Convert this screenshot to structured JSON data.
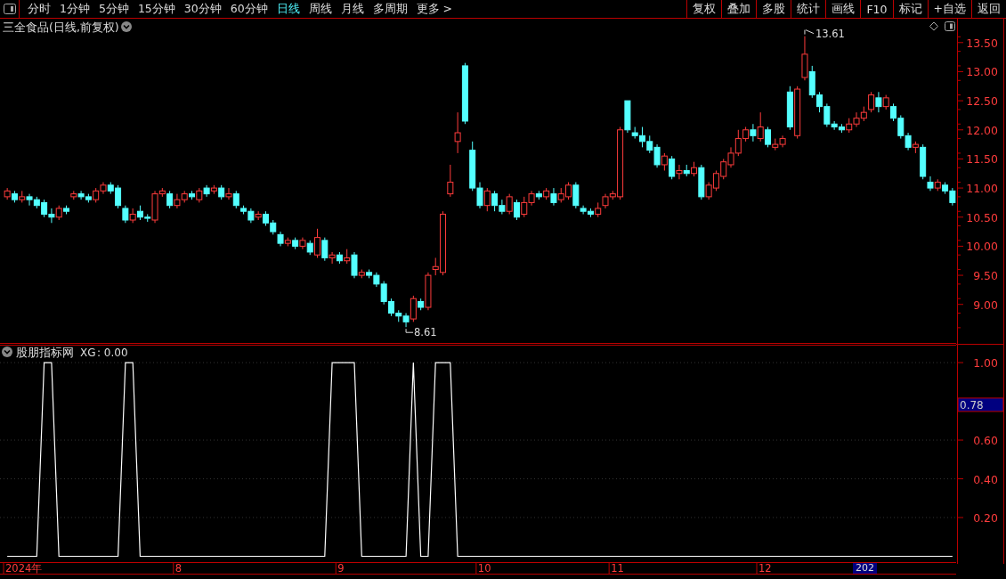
{
  "toolbar": {
    "periods": [
      {
        "label": "分时",
        "selected": false
      },
      {
        "label": "1分钟",
        "selected": false
      },
      {
        "label": "5分钟",
        "selected": false
      },
      {
        "label": "15分钟",
        "selected": false
      },
      {
        "label": "30分钟",
        "selected": false
      },
      {
        "label": "60分钟",
        "selected": false
      },
      {
        "label": "日线",
        "selected": true
      },
      {
        "label": "周线",
        "selected": false
      },
      {
        "label": "月线",
        "selected": false
      },
      {
        "label": "多周期",
        "selected": false
      },
      {
        "label": "更多 >",
        "selected": false
      }
    ],
    "buttons": [
      "复权",
      "叠加",
      "多股",
      "统计",
      "画线",
      "F10",
      "标记",
      "+自选",
      "返回"
    ]
  },
  "price_chart": {
    "title": "三全食品(日线,前复权)",
    "high_label": "13.61",
    "low_label": "8.61",
    "chart_data": {
      "type": "candlestick",
      "yticks": [
        {
          "value": 13.5,
          "label": "13.50"
        },
        {
          "value": 13,
          "label": "13.00"
        },
        {
          "value": 12.5,
          "label": "12.50"
        },
        {
          "value": 12,
          "label": "12.00"
        },
        {
          "value": 11.5,
          "label": "11.50"
        },
        {
          "value": 11,
          "label": "11.00"
        },
        {
          "value": 10.5,
          "label": "10.50"
        },
        {
          "value": 10,
          "label": "10.00"
        },
        {
          "value": 9.5,
          "label": "9.50"
        },
        {
          "value": 9,
          "label": "9.00"
        }
      ],
      "ylim": [
        8.33,
        13.91
      ],
      "categories": [
        null,
        null,
        null,
        null,
        null,
        null,
        null,
        null,
        null,
        null,
        null,
        null,
        null,
        null,
        null,
        null,
        null,
        null,
        null,
        null,
        null,
        null,
        null,
        null,
        null,
        null,
        null,
        null,
        null,
        null,
        null,
        null,
        null,
        null,
        null,
        null,
        null,
        null,
        null,
        null,
        null,
        null,
        null,
        null,
        null,
        null,
        null,
        null,
        null,
        null,
        null,
        null,
        null,
        null,
        null,
        null,
        null,
        null,
        null,
        null,
        null,
        null,
        null,
        null,
        null,
        null,
        null,
        null,
        null,
        null,
        null,
        null,
        null,
        null,
        null,
        null,
        null,
        null,
        null,
        null,
        null,
        null,
        null,
        null,
        null,
        null,
        null,
        null,
        null,
        null,
        null,
        null,
        null,
        null,
        null,
        null,
        null,
        null,
        null,
        null,
        null,
        null,
        null,
        null,
        null,
        null,
        null,
        null,
        null,
        null,
        null,
        null,
        null,
        null,
        null,
        null,
        null,
        null,
        null,
        null,
        null,
        null,
        null,
        null,
        null,
        null,
        null,
        null,
        null
      ],
      "ohlc": [
        [
          10.85,
          11.0,
          10.8,
          10.95
        ],
        [
          10.9,
          10.95,
          10.75,
          10.8
        ],
        [
          10.8,
          10.95,
          10.75,
          10.85
        ],
        [
          10.85,
          10.9,
          10.7,
          10.8
        ],
        [
          10.8,
          10.85,
          10.65,
          10.7
        ],
        [
          10.75,
          10.8,
          10.5,
          10.55
        ],
        [
          10.55,
          10.65,
          10.4,
          10.5
        ],
        [
          10.5,
          10.7,
          10.45,
          10.65
        ],
        [
          10.65,
          10.7,
          10.55,
          10.6
        ],
        [
          10.85,
          10.95,
          10.8,
          10.9
        ],
        [
          10.9,
          10.95,
          10.8,
          10.85
        ],
        [
          10.85,
          10.9,
          10.75,
          10.8
        ],
        [
          10.8,
          11.0,
          10.75,
          10.95
        ],
        [
          10.95,
          11.1,
          10.9,
          11.05
        ],
        [
          11.05,
          11.1,
          10.9,
          10.95
        ],
        [
          11.0,
          11.05,
          10.65,
          10.7
        ],
        [
          10.65,
          10.7,
          10.4,
          10.45
        ],
        [
          10.45,
          10.65,
          10.4,
          10.55
        ],
        [
          10.6,
          10.7,
          10.45,
          10.5
        ],
        [
          10.5,
          10.55,
          10.42,
          10.48
        ],
        [
          10.45,
          10.95,
          10.4,
          10.9
        ],
        [
          10.9,
          11.0,
          10.85,
          10.95
        ],
        [
          10.9,
          10.95,
          10.65,
          10.7
        ],
        [
          10.7,
          10.9,
          10.65,
          10.8
        ],
        [
          10.8,
          10.95,
          10.75,
          10.9
        ],
        [
          10.9,
          10.95,
          10.8,
          10.85
        ],
        [
          10.8,
          11.0,
          10.75,
          10.95
        ],
        [
          11.0,
          11.05,
          10.85,
          10.9
        ],
        [
          10.95,
          11.05,
          10.9,
          11.0
        ],
        [
          11.0,
          11.05,
          10.8,
          10.85
        ],
        [
          10.85,
          11.0,
          10.8,
          10.9
        ],
        [
          10.9,
          10.95,
          10.65,
          10.7
        ],
        [
          10.65,
          10.7,
          10.55,
          10.6
        ],
        [
          10.6,
          10.65,
          10.4,
          10.45
        ],
        [
          10.5,
          10.6,
          10.45,
          10.55
        ],
        [
          10.55,
          10.6,
          10.35,
          10.4
        ],
        [
          10.4,
          10.45,
          10.2,
          10.25
        ],
        [
          10.2,
          10.25,
          10.0,
          10.05
        ],
        [
          10.05,
          10.15,
          10.0,
          10.1
        ],
        [
          10.1,
          10.15,
          9.95,
          10.0
        ],
        [
          10.0,
          10.15,
          9.95,
          10.1
        ],
        [
          10.05,
          10.1,
          9.85,
          9.9
        ],
        [
          9.85,
          10.3,
          9.8,
          10.15
        ],
        [
          10.1,
          10.15,
          9.75,
          9.8
        ],
        [
          9.8,
          9.9,
          9.7,
          9.85
        ],
        [
          9.85,
          9.9,
          9.7,
          9.75
        ],
        [
          9.75,
          9.95,
          9.7,
          9.8
        ],
        [
          9.85,
          9.9,
          9.45,
          9.5
        ],
        [
          9.5,
          9.6,
          9.45,
          9.55
        ],
        [
          9.55,
          9.6,
          9.45,
          9.5
        ],
        [
          9.5,
          9.55,
          9.3,
          9.35
        ],
        [
          9.35,
          9.4,
          9.0,
          9.05
        ],
        [
          9.05,
          9.1,
          8.8,
          8.85
        ],
        [
          8.85,
          8.9,
          8.7,
          8.8
        ],
        [
          8.8,
          8.85,
          8.61,
          8.7
        ],
        [
          8.75,
          9.15,
          8.7,
          9.1
        ],
        [
          9.05,
          9.1,
          8.9,
          8.95
        ],
        [
          8.95,
          9.55,
          8.9,
          9.5
        ],
        [
          9.6,
          9.8,
          9.5,
          9.65
        ],
        [
          9.55,
          10.6,
          9.5,
          10.55
        ],
        [
          10.9,
          11.4,
          10.85,
          11.1
        ],
        [
          11.8,
          12.3,
          11.6,
          11.95
        ],
        [
          13.1,
          13.15,
          12.1,
          12.15
        ],
        [
          11.65,
          11.8,
          10.95,
          11.0
        ],
        [
          11.0,
          11.1,
          10.65,
          10.7
        ],
        [
          10.7,
          11.0,
          10.6,
          10.95
        ],
        [
          10.9,
          10.95,
          10.6,
          10.7
        ],
        [
          10.7,
          10.8,
          10.55,
          10.6
        ],
        [
          10.6,
          10.9,
          10.55,
          10.85
        ],
        [
          10.75,
          10.8,
          10.45,
          10.5
        ],
        [
          10.55,
          10.85,
          10.5,
          10.75
        ],
        [
          10.75,
          10.95,
          10.7,
          10.9
        ],
        [
          10.9,
          10.95,
          10.8,
          10.85
        ],
        [
          10.85,
          11.0,
          10.8,
          10.95
        ],
        [
          10.9,
          11.0,
          10.7,
          10.75
        ],
        [
          10.8,
          11.0,
          10.75,
          10.9
        ],
        [
          10.85,
          11.1,
          10.8,
          11.05
        ],
        [
          11.05,
          11.1,
          10.65,
          10.7
        ],
        [
          10.65,
          10.7,
          10.55,
          10.6
        ],
        [
          10.6,
          10.65,
          10.5,
          10.55
        ],
        [
          10.55,
          10.75,
          10.5,
          10.65
        ],
        [
          10.7,
          10.9,
          10.65,
          10.85
        ],
        [
          10.85,
          10.95,
          10.8,
          10.9
        ],
        [
          10.85,
          12.05,
          10.8,
          12.0
        ],
        [
          12.5,
          12.5,
          11.95,
          12.0
        ],
        [
          11.95,
          12.05,
          11.85,
          11.9
        ],
        [
          11.9,
          12.05,
          11.7,
          11.8
        ],
        [
          11.8,
          11.9,
          11.6,
          11.65
        ],
        [
          11.7,
          11.75,
          11.35,
          11.4
        ],
        [
          11.4,
          11.6,
          11.3,
          11.55
        ],
        [
          11.5,
          11.55,
          11.15,
          11.2
        ],
        [
          11.25,
          11.4,
          11.15,
          11.3
        ],
        [
          11.3,
          11.4,
          11.2,
          11.25
        ],
        [
          11.25,
          11.45,
          11.2,
          11.35
        ],
        [
          11.35,
          11.4,
          10.8,
          10.85
        ],
        [
          10.85,
          11.1,
          10.8,
          11.05
        ],
        [
          11.0,
          11.3,
          10.95,
          11.25
        ],
        [
          11.2,
          11.5,
          11.15,
          11.45
        ],
        [
          11.4,
          11.7,
          11.35,
          11.6
        ],
        [
          11.6,
          12.0,
          11.55,
          11.85
        ],
        [
          11.85,
          12.05,
          11.8,
          12.0
        ],
        [
          12.0,
          12.1,
          11.8,
          11.9
        ],
        [
          11.85,
          12.3,
          11.8,
          12.05
        ],
        [
          12.0,
          12.05,
          11.7,
          11.75
        ],
        [
          11.7,
          11.85,
          11.65,
          11.75
        ],
        [
          11.75,
          11.9,
          11.7,
          11.85
        ],
        [
          12.65,
          12.75,
          12.0,
          12.05
        ],
        [
          11.9,
          12.75,
          11.85,
          12.7
        ],
        [
          12.9,
          13.61,
          12.85,
          13.3
        ],
        [
          13.0,
          13.1,
          12.55,
          12.6
        ],
        [
          12.6,
          12.65,
          12.3,
          12.4
        ],
        [
          12.4,
          12.45,
          12.05,
          12.1
        ],
        [
          12.1,
          12.15,
          12.0,
          12.05
        ],
        [
          12.05,
          12.1,
          11.95,
          12.0
        ],
        [
          12.0,
          12.2,
          11.95,
          12.1
        ],
        [
          12.1,
          12.3,
          12.05,
          12.2
        ],
        [
          12.2,
          12.4,
          12.15,
          12.3
        ],
        [
          12.35,
          12.65,
          12.3,
          12.6
        ],
        [
          12.55,
          12.65,
          12.3,
          12.4
        ],
        [
          12.4,
          12.6,
          12.35,
          12.55
        ],
        [
          12.4,
          12.45,
          12.15,
          12.2
        ],
        [
          12.2,
          12.25,
          11.85,
          11.9
        ],
        [
          11.9,
          11.95,
          11.65,
          11.7
        ],
        [
          11.7,
          11.8,
          11.6,
          11.75
        ],
        [
          11.7,
          11.75,
          11.15,
          11.2
        ],
        [
          11.1,
          11.2,
          10.95,
          11.0
        ],
        [
          11.0,
          11.15,
          10.95,
          11.1
        ],
        [
          11.05,
          11.1,
          10.9,
          10.95
        ],
        [
          10.95,
          11.0,
          10.7,
          10.75
        ]
      ]
    }
  },
  "indicator": {
    "name": "股朋指标网",
    "reading": ": 0.00",
    "cursor_value": "0.78",
    "chart_data": {
      "type": "line",
      "yticks": [
        {
          "value": 1,
          "label": "1.00"
        },
        {
          "value": 0.6,
          "label": "0.60"
        },
        {
          "value": 0.4,
          "label": "0.40"
        },
        {
          "value": 0.2,
          "label": "0.20"
        }
      ],
      "ylim": [
        -0.03,
        1.09
      ],
      "categories": [
        null,
        null,
        null,
        null,
        null,
        null,
        null,
        null,
        null,
        null,
        null,
        null,
        null,
        null,
        null,
        null,
        null,
        null,
        null,
        null,
        null,
        null,
        null,
        null,
        null,
        null,
        null,
        null,
        null,
        null,
        null,
        null,
        null,
        null,
        null,
        null,
        null,
        null,
        null,
        null,
        null,
        null,
        null,
        null,
        null,
        null,
        null,
        null,
        null,
        null,
        null,
        null,
        null,
        null,
        null,
        null,
        null,
        null,
        null,
        null,
        null,
        null,
        null,
        null,
        null,
        null,
        null,
        null,
        null,
        null,
        null,
        null,
        null,
        null,
        null,
        null,
        null,
        null,
        null,
        null,
        null,
        null,
        null,
        null,
        null,
        null,
        null,
        null,
        null,
        null,
        null,
        null,
        null,
        null,
        null,
        null,
        null,
        null,
        null,
        null,
        null,
        null,
        null,
        null,
        null,
        null,
        null,
        null,
        null,
        null,
        null,
        null,
        null,
        null,
        null,
        null,
        null,
        null,
        null,
        null,
        null,
        null,
        null,
        null,
        null,
        null,
        null,
        null,
        null
      ],
      "series": [
        {
          "name": "XG",
          "color": "#ffffff",
          "values": [
            0,
            0,
            0,
            0,
            0,
            1,
            1,
            0,
            0,
            0,
            0,
            0,
            0,
            0,
            0,
            0,
            1,
            1,
            0,
            0,
            0,
            0,
            0,
            0,
            0,
            0,
            0,
            0,
            0,
            0,
            0,
            0,
            0,
            0,
            0,
            0,
            0,
            0,
            0,
            0,
            0,
            0,
            0,
            0,
            1,
            1,
            1,
            1,
            0,
            0,
            0,
            0,
            0,
            0,
            0,
            1,
            0,
            0,
            1,
            1,
            1,
            0,
            0,
            0,
            0,
            0,
            0,
            0,
            0,
            0,
            0,
            0,
            0,
            0,
            0,
            0,
            0,
            0,
            0,
            0,
            0,
            0,
            0,
            0,
            0,
            0,
            0,
            0,
            0,
            0,
            0,
            0,
            0,
            0,
            0,
            0,
            0,
            0,
            0,
            0,
            0,
            0,
            0,
            0,
            0,
            0,
            0,
            0,
            0,
            0,
            0,
            0,
            0,
            0,
            0,
            0,
            0,
            0,
            0,
            0,
            0,
            0,
            0,
            0,
            0,
            0,
            0,
            0,
            0
          ]
        }
      ]
    }
  },
  "date_axis": {
    "labels": [
      "2024年",
      "8",
      "9",
      "10",
      "11",
      "12"
    ],
    "cursor_label": "202"
  }
}
